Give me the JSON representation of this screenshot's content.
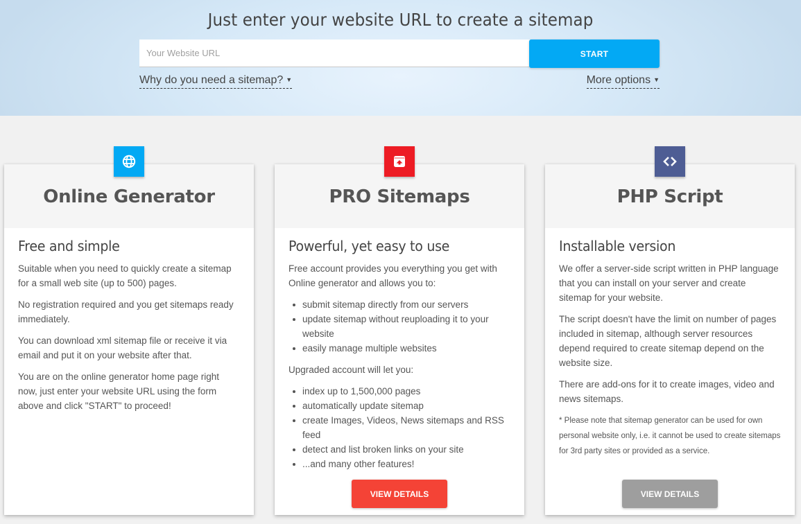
{
  "hero": {
    "title": "Just enter your website URL to create a sitemap",
    "url_input": {
      "value": "",
      "placeholder": "Your Website URL"
    },
    "start_label": "START",
    "why_link": "Why do you need a sitemap?",
    "more_options_link": "More options",
    "caret": "▼",
    "colors": {
      "start": "#03a9f4"
    }
  },
  "cards": [
    {
      "icon": "globe-icon",
      "color": "#03a9f4",
      "title": "Online Generator",
      "subtitle": "Free and simple",
      "paragraphs": [
        "Suitable when you need to quickly create a sitemap for a small web site (up to 500) pages.",
        "No registration required and you get sitemaps ready immediately.",
        "You can download xml sitemap file or receive it via email and put it on your website after that.",
        "You are on the online generator home page right now, just enter your website URL using the form above and click \"START\" to proceed!"
      ]
    },
    {
      "icon": "upload-box-icon",
      "color": "#ed1c24",
      "title": "PRO Sitemaps",
      "subtitle": "Powerful, yet easy to use",
      "intro_free": "Free account provides you everything you get with Online generator and allows you to:",
      "free_features": [
        "submit sitemap directly from our servers",
        "update sitemap without reuploading it to your website",
        "easily manage multiple websites"
      ],
      "intro_upgraded": "Upgraded account will let you:",
      "upgraded_features": [
        "index up to 1,500,000 pages",
        "automatically update sitemap",
        "create Images, Videos, News sitemaps and RSS feed",
        "detect and list broken links on your site",
        "...and many other features!"
      ],
      "button_label": "VIEW DETAILS",
      "button_color": "#f44336"
    },
    {
      "icon": "code-icon",
      "color": "#4e5d94",
      "title": "PHP Script",
      "subtitle": "Installable version",
      "paragraphs": [
        "We offer a server-side script written in PHP language that you can install on your server and create sitemap for your website.",
        "The script doesn't have the limit on number of pages included in sitemap, although server resources depend required to create sitemap depend on the website size.",
        "There are add-ons for it to create images, video and news sitemaps."
      ],
      "note": "* Please note that sitemap generator can be used for own personal website only, i.e. it cannot be used to create sitemaps for 3rd party sites or provided as a service.",
      "button_label": "VIEW DETAILS",
      "button_color": "#9e9e9e"
    }
  ]
}
